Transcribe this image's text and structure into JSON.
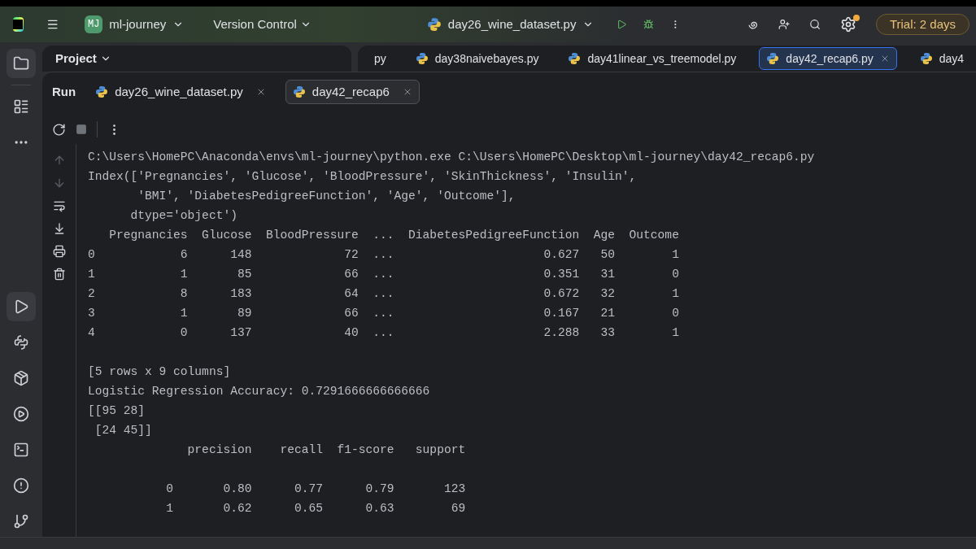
{
  "title_bar": {
    "project": {
      "initials": "MJ",
      "name": "ml-journey"
    },
    "vcs": "Version Control",
    "run_config": "day26_wine_dataset.py",
    "trial": "Trial: 2 days",
    "settings_badge": true
  },
  "project_panel": {
    "title": "Project"
  },
  "editor_tabs": [
    {
      "label": "py",
      "selected": false
    },
    {
      "label": "day38naivebayes.py",
      "selected": false
    },
    {
      "label": "day41linear_vs_treemodel.py",
      "selected": false
    },
    {
      "label": "day42_recap6.py",
      "selected": true
    },
    {
      "label": "day4",
      "selected": false
    }
  ],
  "run_panel": {
    "title": "Run",
    "tabs": [
      {
        "label": "day26_wine_dataset.py",
        "selected": false
      },
      {
        "label": "day42_recap6",
        "selected": true
      }
    ],
    "console_blocks": [
      {
        "lines": [
          "C:\\Users\\HomePC\\Anaconda\\envs\\ml-journey\\python.exe C:\\Users\\HomePC\\Desktop\\ml-journey\\day42_recap6.py",
          "Index(['Pregnancies', 'Glucose', 'BloodPressure', 'SkinThickness', 'Insulin',",
          "       'BMI', 'DiabetesPedigreeFunction', 'Age', 'Outcome'],",
          "      dtype='object')",
          "   Pregnancies  Glucose  BloodPressure  ...  DiabetesPedigreeFunction  Age  Outcome",
          "0            6      148             72  ...                     0.627   50        1",
          "1            1       85             66  ...                     0.351   31        0",
          "2            8      183             64  ...                     0.672   32        1",
          "3            1       89             66  ...                     0.167   21        0",
          "4            0      137             40  ...                     2.288   33        1"
        ]
      },
      {
        "lines": [
          "[5 rows x 9 columns]",
          "Logistic Regression Accuracy: 0.7291666666666666",
          "[[95 28]",
          " [24 45]]",
          "              precision    recall  f1-score   support"
        ]
      },
      {
        "lines": [
          "           0       0.80      0.77      0.79       123",
          "           1       0.62      0.65      0.63        69"
        ]
      }
    ]
  }
}
